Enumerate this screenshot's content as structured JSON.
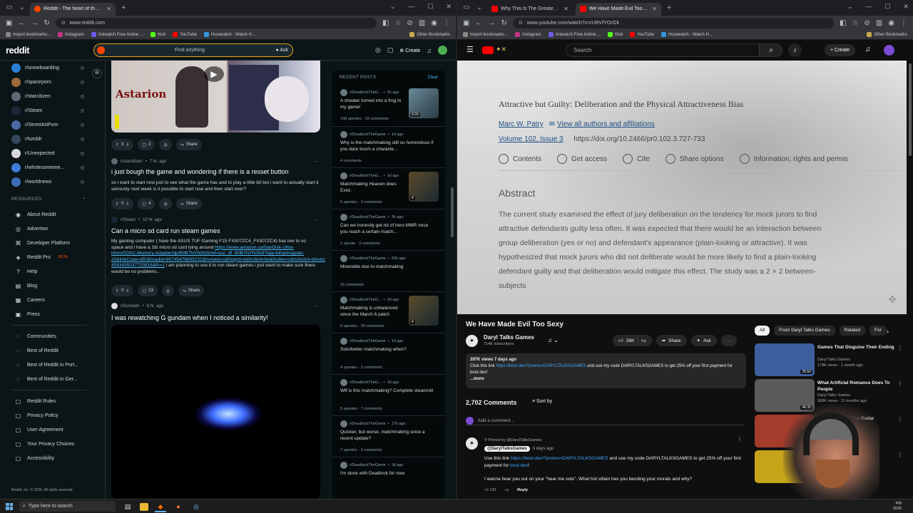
{
  "left": {
    "tab": {
      "title": "Reddit - The heart of the internet",
      "active": true
    },
    "url": "www.reddit.com",
    "bookmarks": [
      "Import bookmarks...",
      "Instagram",
      "Aniwatch Free Anime ...",
      "Kick",
      "YouTube",
      "Hurawatch - Watch H..."
    ],
    "other_bookmarks": "Other Bookmarks",
    "header": {
      "logo": "reddit",
      "search_placeholder": "Find anything",
      "ask": "Ask",
      "create": "Create"
    },
    "subreddits": [
      {
        "name": "r/snowboarding",
        "color": "#2a7fd4"
      },
      {
        "name": "r/spaceporn",
        "color": "#9e6a3a"
      },
      {
        "name": "r/starcitizen",
        "color": "#5b6a75"
      },
      {
        "name": "r/Steam",
        "color": "#1b2838"
      },
      {
        "name": "r/StreetArtPorn",
        "color": "#4a6aa8"
      },
      {
        "name": "r/tumblr",
        "color": "#35465c"
      },
      {
        "name": "r/Unexpected",
        "color": "#d8d8d8"
      },
      {
        "name": "r/wholesomeme...",
        "color": "#3b7dd8"
      },
      {
        "name": "r/worldnews",
        "color": "#3b6db8"
      }
    ],
    "resources_heading": "RESOURCES",
    "resources": [
      "About Reddit",
      "Advertise",
      "Developer Platform",
      "Reddit Pro",
      "Help",
      "Blog",
      "Careers",
      "Press"
    ],
    "beta": "BETA",
    "communities": [
      "Communities",
      "Best of Reddit",
      "Best of Reddit in Port...",
      "Best of Reddit in Ger..."
    ],
    "policies": [
      "Reddit Rules",
      "Privacy Policy",
      "User Agreement",
      "Your Privacy Choices",
      "Accessibility"
    ],
    "copyright": "Reddit, Inc. © 2026. All rights reserved.",
    "posts": [
      {
        "image_text": "Astarion",
        "votes": "3",
        "comments": "2",
        "share": "Share"
      },
      {
        "sub": "r/starcitizen",
        "time": "7 hr. ago",
        "title": "i just bough the game and wondering if there is a resset button",
        "body": "so i want to start now just to see what the game has and to play a little bit but i want to actually start it seriously next week is it possible to start now and then start over?",
        "votes": "0",
        "comments": "4",
        "share": "Share"
      },
      {
        "sub": "r/Steam",
        "time": "10 hr. ago",
        "title": "Can a micro sd card run steam games",
        "body_start": "My gaming computer ( have the ASUS TUF Gaming F15 FX507ZC4_FX507ZC4) has low to no space and i have a 1tb micro sd card lying around ",
        "body_link": "https://www.amazon.ca/SanDisk-Ultra-microSDXC-Memory-Adapter/dp/B0B7NYN3N3/ref=asc_df_B0B7NYN3N3?tag=bingshoppde-20&linkCode=df0&hvadid=80745476895231&hvnetw=o&hvqmt=e&hvbmt=be&hvdev=c&hvlocint=&hvlocphy=124221&hvtargid=pla-4583435037723816&th=1",
        "body_end": " i am planning to use it to run steam games i just want to make sure there would be no problems...",
        "votes": "0",
        "comments": "13",
        "share": "Share"
      },
      {
        "sub": "r/Gundam",
        "time": "6 hr. ago",
        "title": "I was rewatching G gundam when I noticed a similarity!"
      }
    ],
    "recent": {
      "heading": "RECENT POSTS",
      "clear": "Clear",
      "items": [
        {
          "sub": "r/DeadlockTheG...",
          "time": "5h ago",
          "title": "A cheater turned into a frog in my game!",
          "stats": "146 upvotes · 15 comments",
          "thumb": "0:20"
        },
        {
          "sub": "r/DeadlockTheGame",
          "time": "1d ago",
          "title": "Why is the matchmaking still so horrendous if you dare touch a characte...",
          "stats": "4 comments"
        },
        {
          "sub": "r/DeadlockTheG...",
          "time": "1d ago",
          "title": "Matchmaking Heaven does Exist.",
          "stats": "5 upvotes · 3 comments",
          "thumb": "4"
        },
        {
          "sub": "r/DeadlockTheGame",
          "time": "3h ago",
          "title": "Can we honestly get rid of hero MMR once you reach a certain match...",
          "stats": "1 upvote · 3 comments"
        },
        {
          "sub": "r/DeadlockTheGame",
          "time": "20h ago",
          "title": "Miserable due to matchmaking",
          "stats": "15 comments"
        },
        {
          "sub": "r/DeadlockTheG...",
          "time": "2d ago",
          "title": "Matchmaking is unbalanced since the March 6 patch",
          "stats": "9 upvotes · 20 comments",
          "thumb": "4"
        },
        {
          "sub": "r/DeadlockTheGame",
          "time": "1d ago",
          "title": "Solo/better matchmaking when?",
          "stats": "4 upvotes · 2 comments"
        },
        {
          "sub": "r/DeadlockTheG...",
          "time": "1d ago",
          "title": "Wtf is this matchmaking? Complete steamroll",
          "stats": "5 upvotes · 7 comments"
        },
        {
          "sub": "r/DeadlockTheGame",
          "time": "17h ago",
          "title": "Quicker, but worse, matchmaking since a recent update?",
          "stats": "7 upvotes · 2 comments"
        },
        {
          "sub": "r/DeadlockTheGame",
          "time": "3d ago",
          "title": "I'm done with Deadlock for now",
          "stats": ""
        }
      ]
    }
  },
  "right": {
    "tabs": [
      {
        "title": "Why This Is The Greatest Lord O...",
        "active": false
      },
      {
        "title": "We Have Made Evil Too Sexy",
        "active": true
      }
    ],
    "url": "www.youtube.com/watch?v=rURVfYOrf2k",
    "bookmarks": [
      "Import bookmarks...",
      "Instagram",
      "Aniwatch Free Anime ...",
      "Kick",
      "YouTube",
      "Hurawatch - Watch H..."
    ],
    "other_bookmarks": "Other Bookmarks",
    "header": {
      "search_placeholder": "Search",
      "create": "Create"
    },
    "video_frame": {
      "paper_title": "Attractive but Guilty: Deliberation and the Physical Attractiveness Bias",
      "author": "Marc W. Patry",
      "all_authors": "View all authors and affiliations",
      "volume": "Volume 102, Issue 3",
      "doi": "https://doi.org/10.2466/pr0.102.3.727-733",
      "toolbar": [
        "Contents",
        "Get access",
        "Cite",
        "Share options",
        "Information, rights and permis"
      ],
      "abstract_heading": "Abstract",
      "abstract": "The current study examined the effect of jury deliberation on the tendency for mock jurors to find attractive defendants guilty less often. It was expected that there would be an interaction between group deliberation (yes or no) and defendant's appearance (plain-looking or attractive). It was hypothesized that mock jurors who did not deliberate would be more likely to find a plain-looking defendant guilty and that deliberation would mitigate this effect. The study was a 2 × 2 between-subjects"
    },
    "video": {
      "title": "We Have Made Evil Too Sexy",
      "channel": "Daryl Talks Games",
      "subscribers": "714K subscribers",
      "likes": "26K",
      "share": "Share",
      "ask": "Ask",
      "views": "297K views",
      "age": "7 days ago",
      "desc_pre": "Click this link ",
      "desc_link": "https://boot.dev/?promo=DARYLTALKSGAMES",
      "desc_post": " and use my code DARYLTALKSGAMES to get 25% off your first payment for boot.dev!",
      "more": "...more"
    },
    "comments": {
      "count": "2,702 Comments",
      "sort": "Sort by",
      "add": "Add a comment...",
      "pinned_by": "Pinned by @DarylTalksGames",
      "author": "@DarylTalksGames",
      "age": "3 days ago",
      "text_pre": "Use this link ",
      "text_link": "https://boot.dev/?promo=DARYLTALKSGAMES",
      "text_post": " and use my code DARYLTALKSGAMES to get 25% off your first payment for ",
      "text_link2": "boot.dev",
      "text_end": "!",
      "line2": "I wanna hear you out on your \"hear me outs\". What hot villain has you bending your morals and why?",
      "likes": "132",
      "reply": "Reply"
    },
    "chips": [
      "All",
      "From Daryl Talks Games",
      "Related",
      "For"
    ],
    "recommended": [
      {
        "title": "Games That Disguise Their Ending",
        "channel": "Daryl Talks Games",
        "meta": "174K views · 1 month ago",
        "duration": "25:56",
        "thumb_color": "#3d5f9e"
      },
      {
        "title": "What Artificial Romance Does To People",
        "channel": "Daryl Talks Games",
        "meta": "993K views · 11 months ago",
        "duration": "46:35",
        "thumb_color": "#5a5a5a"
      },
      {
        "title": "Games in 2026 You Radar",
        "channel": "",
        "meta": "...rs ago",
        "duration": "",
        "thumb_color": "#a43c2c"
      },
      {
        "title": "Files",
        "channel": "",
        "meta": "...go",
        "duration": "",
        "thumb_color": "#c6a41a"
      }
    ]
  },
  "taskbar": {
    "search": "Type here to search",
    "time": "PM",
    "date": "2026"
  }
}
